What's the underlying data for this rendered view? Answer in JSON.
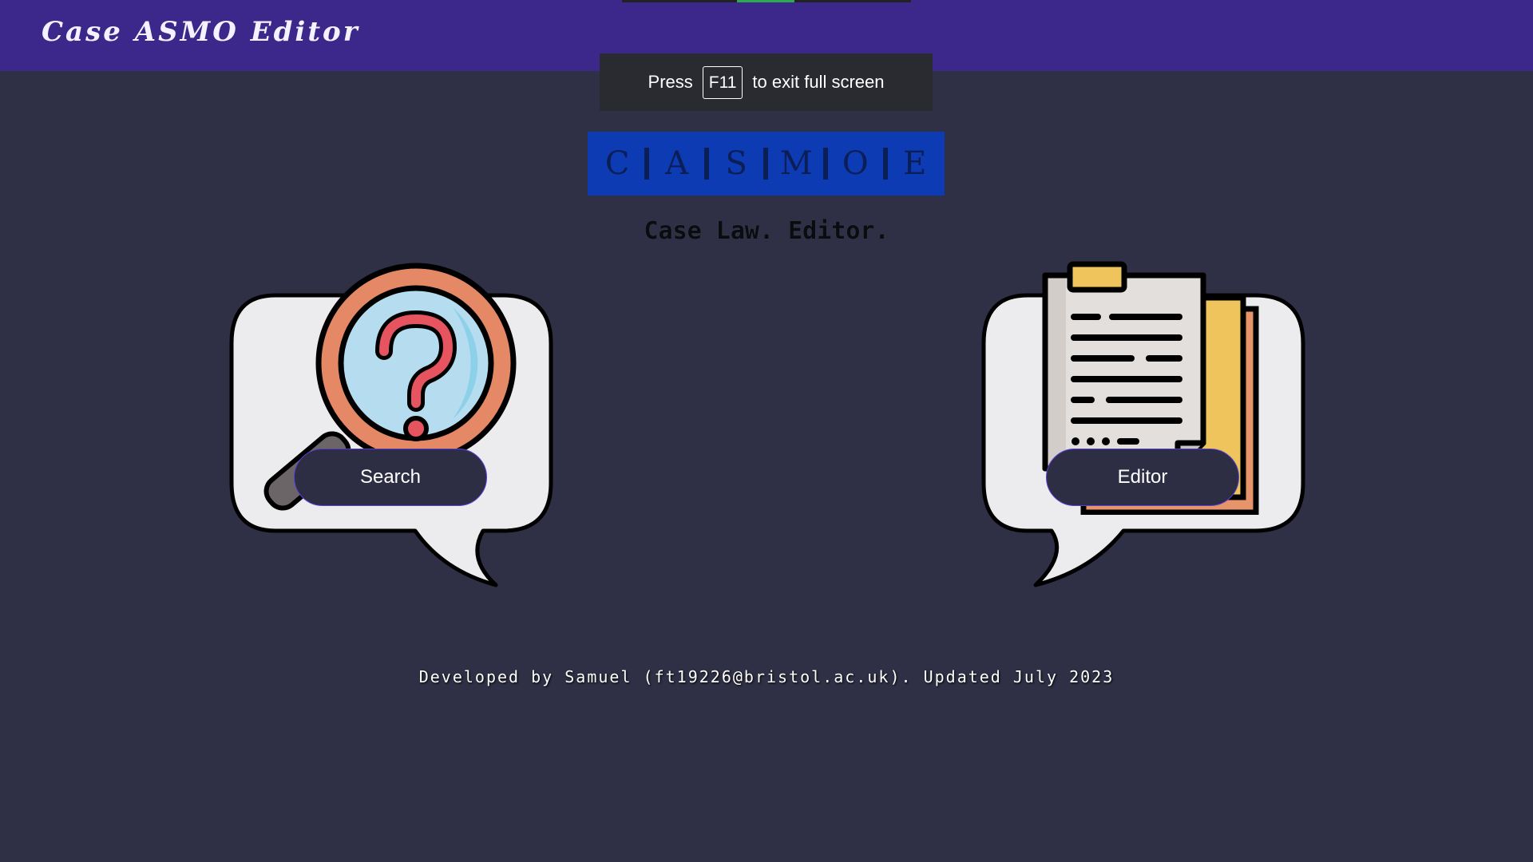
{
  "header": {
    "title": "Case ASMO Editor"
  },
  "fullscreen_notice": {
    "before": "Press",
    "key": "F11",
    "after": "to exit full screen"
  },
  "logo": {
    "letters": [
      "C",
      "A",
      "S",
      "M",
      "O",
      "E"
    ]
  },
  "tagline": "Case Law. Editor.",
  "cards": {
    "search": {
      "label": "Search",
      "icon": "magnifier-question-icon"
    },
    "editor": {
      "label": "Editor",
      "icon": "clipboard-document-icon"
    }
  },
  "footer": {
    "text": "Developed by Samuel (ft19226@bristol.ac.uk). Updated July 2023"
  },
  "colors": {
    "header_bg": "#3c288a",
    "page_bg": "#2f2f45",
    "logo_bg": "#0c3bb4",
    "button_bg": "#2d2d43",
    "button_border": "#5a3fd6"
  }
}
